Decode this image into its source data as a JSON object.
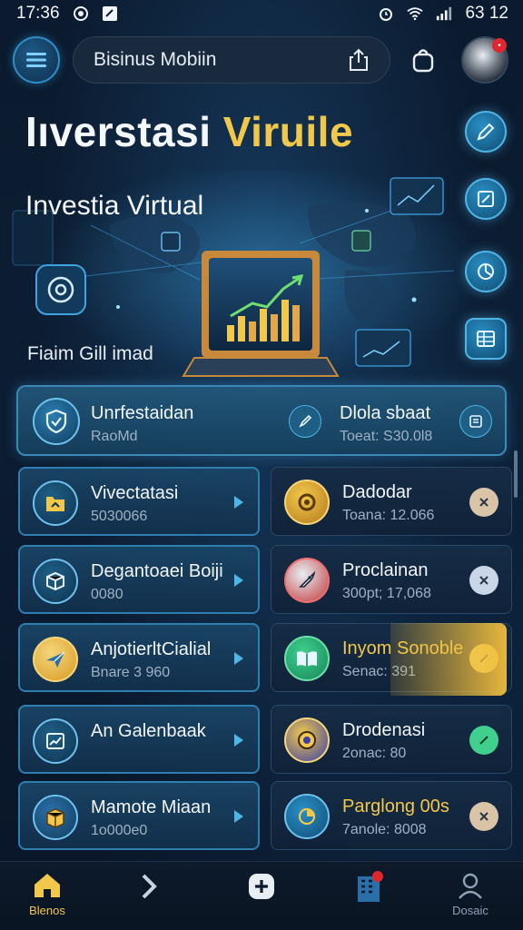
{
  "status_bar": {
    "time": "17:36",
    "battery": "63 12"
  },
  "header": {
    "search_label": "Bisinus Mobiin",
    "icons": [
      "menu-icon",
      "share-icon",
      "bag-icon",
      "avatar"
    ]
  },
  "hero": {
    "title_part1": "Iıverstasi",
    "title_part2": "Viruile",
    "subtitle": "Investia Virtual",
    "caption": "Fiaim Gill imad"
  },
  "wide_card": {
    "title": "Unrfestaidan",
    "subtitle": "RaoMd",
    "right_title": "Dlola sbaat",
    "right_sub": "Toeat: S30.0l8"
  },
  "cards": [
    {
      "title": "Vivectatasi",
      "subtitle": "5030066",
      "icon": "folder-icon",
      "kind": "arrow"
    },
    {
      "title": "Dadodar",
      "subtitle": "Toana: 12.066",
      "icon": "gear-coin-icon",
      "kind": "action"
    },
    {
      "title": "Degantoaei Boiji",
      "subtitle": "0080",
      "icon": "box-icon",
      "kind": "arrow"
    },
    {
      "title": "Proclainan",
      "subtitle": "300pt; 17,068",
      "icon": "rocket-icon",
      "kind": "action"
    },
    {
      "title": "AnjotierltCialial",
      "subtitle": "Bnare 3 960",
      "icon": "plane-icon",
      "kind": "arrow"
    },
    {
      "title": "Inyom Sonoble",
      "subtitle": "Senac: 391",
      "icon": "book-icon",
      "kind": "action"
    },
    {
      "title": "An Galenbaak",
      "subtitle": "",
      "icon": "chart-icon",
      "kind": "arrow"
    },
    {
      "title": "Drodenasi",
      "subtitle": "2onac: 80",
      "icon": "coin-icon",
      "kind": "action"
    },
    {
      "title": "Mamote Miaan",
      "subtitle": "1o000e0",
      "icon": "package-icon",
      "kind": "arrow"
    },
    {
      "title": "Parglong 00s",
      "subtitle": "7anole: 8008",
      "icon": "pie-icon",
      "kind": "action"
    }
  ],
  "bottom_nav": [
    {
      "label": "Blenos",
      "icon": "home-icon"
    },
    {
      "label": "",
      "icon": "chevron-right-icon"
    },
    {
      "label": "",
      "icon": "add-icon"
    },
    {
      "label": "",
      "icon": "building-icon"
    },
    {
      "label": "Dosaic",
      "icon": "user-icon"
    }
  ],
  "colors": {
    "accent": "#2e8fc7",
    "gold": "#f2c84b",
    "background": "#0b1a2e",
    "card": "#162c46"
  }
}
